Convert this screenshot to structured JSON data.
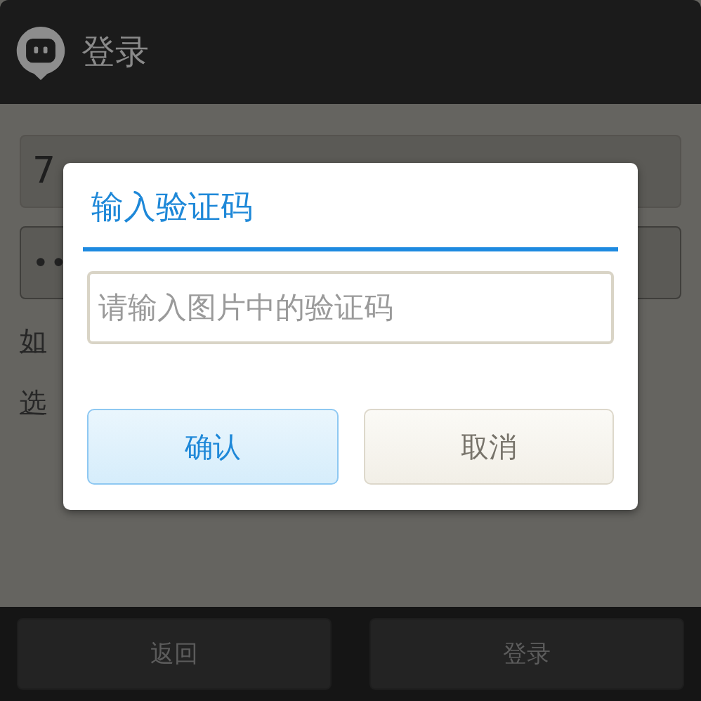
{
  "app_bar": {
    "title": "登录"
  },
  "login_form": {
    "account": "7",
    "password": "••",
    "links": [
      "如",
      "选"
    ]
  },
  "bottom_bar": {
    "buttons": [
      {
        "label": "返回"
      },
      {
        "label": "登录"
      }
    ]
  },
  "dialog": {
    "title": "输入验证码",
    "input": {
      "placeholder": "请输入图片中的验证码"
    },
    "buttons": [
      {
        "label": "确认",
        "kind": "primary"
      },
      {
        "label": "取消",
        "kind": "secondary"
      }
    ]
  }
}
